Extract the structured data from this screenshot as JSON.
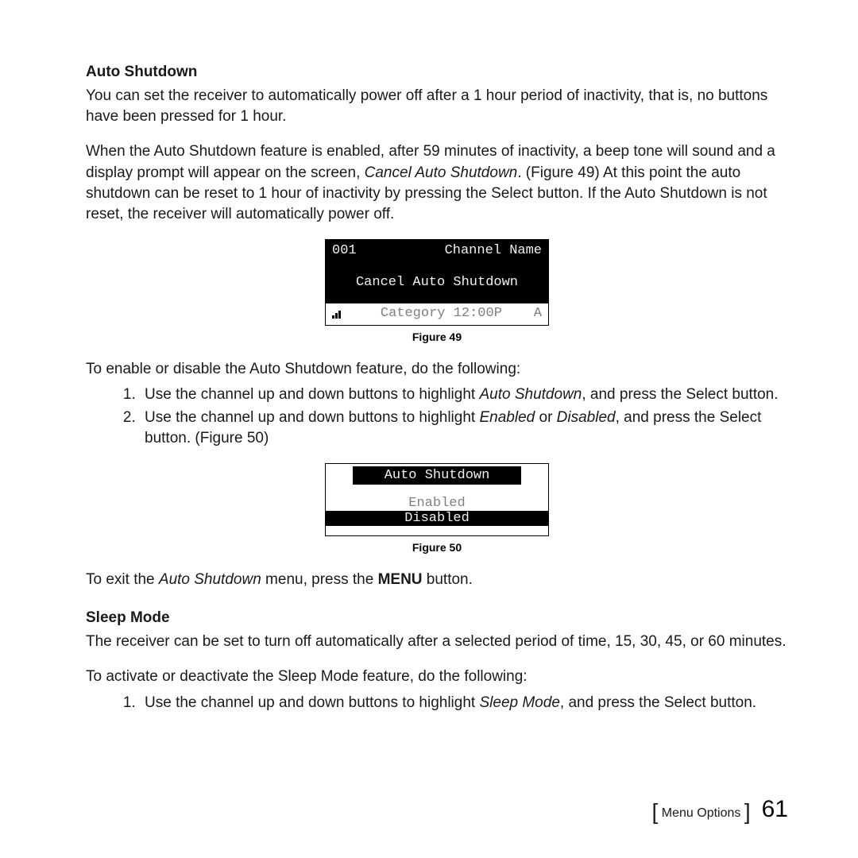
{
  "section1": {
    "heading": "Auto Shutdown",
    "p1": "You can set the receiver to automatically power off after a 1 hour period of inactivity, that is, no buttons have been pressed for 1 hour.",
    "p2_a": "When the Auto Shutdown feature is enabled, after 59 minutes of inactivity, a beep tone will sound and a display prompt will appear on the screen, ",
    "p2_i": "Cancel Auto Shutdown",
    "p2_b": ".  (Figure 49) At this point the auto shutdown can be reset to 1 hour of inactivity by pressing the Select button. If the Auto Shutdown is not reset, the receiver will automatically power off."
  },
  "fig49": {
    "caption": "Figure 49",
    "channel_no": "001",
    "channel_label": "Channel Name",
    "prompt": "Cancel Auto Shutdown",
    "category_text": "Category 12:00P",
    "right_indicator": "A"
  },
  "instructions1": {
    "lead": "To enable or disable the Auto Shutdown feature, do the following:",
    "li1_a": "Use the channel up and down buttons to highlight ",
    "li1_i": "Auto Shutdown",
    "li1_b": ", and press the Select button.",
    "li2_a": "Use the channel up and down buttons to highlight ",
    "li2_i1": "Enabled",
    "li2_mid": " or ",
    "li2_i2": "Disabled",
    "li2_b": ", and press the Select button. (Figure 50)"
  },
  "fig50": {
    "caption": "Figure 50",
    "title": "Auto Shutdown",
    "opt_enabled": "Enabled",
    "opt_disabled": "Disabled"
  },
  "exit": {
    "a": "To exit the ",
    "i": "Auto Shutdown",
    "b": " menu, press the ",
    "btn": "MENU",
    "c": " button."
  },
  "section2": {
    "heading": "Sleep Mode",
    "p1": "The receiver can be set to turn off automatically after a selected period of time, 15, 30, 45, or 60 minutes.",
    "lead": "To activate or deactivate the Sleep Mode feature, do the following:",
    "li1_a": "Use the channel up and down buttons to highlight ",
    "li1_i": "Sleep Mode",
    "li1_b": ", and press the Select button."
  },
  "footer": {
    "section_label": "Menu Options",
    "page": "61"
  }
}
